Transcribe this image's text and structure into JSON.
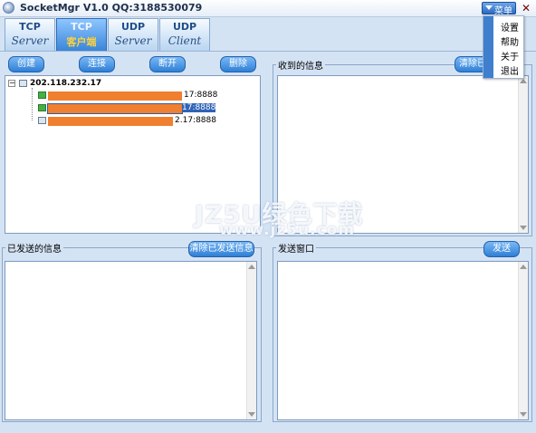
{
  "window": {
    "title": "SocketMgr V1.0  QQ:3188530079",
    "menu_label": "菜单",
    "close_glyph": "✕"
  },
  "menu_items": [
    "设置",
    "帮助",
    "关于",
    "退出"
  ],
  "tabs": [
    {
      "line1": "TCP",
      "line2": "Server"
    },
    {
      "line1": "TCP",
      "line2": "客户端"
    },
    {
      "line1": "UDP",
      "line2": "Server"
    },
    {
      "line1": "UDP",
      "line2": "Client"
    }
  ],
  "active_tab": 1,
  "toolbar": {
    "create": "创建",
    "connect": "连接",
    "disconnect": "断开",
    "delete": "删除"
  },
  "tree": {
    "root": "202.118.232.17",
    "connections": [
      {
        "label": "17:8888",
        "selected": false
      },
      {
        "label": "17:8888",
        "selected": true
      },
      {
        "label": "2.17:8888",
        "selected": false
      }
    ]
  },
  "received": {
    "group_label": "收到的信息",
    "clear_button": "清除已"
  },
  "sent": {
    "group_label": "已发送的信息",
    "clear_button": "清除已发送信息"
  },
  "send_window": {
    "group_label": "发送窗口",
    "send_button": "发送"
  },
  "watermark": {
    "line1": "JZ5U绿色下载",
    "line2": "www.jz5u.com"
  },
  "colors": {
    "accent": "#2f7fd6",
    "connection_bar": "#f07f2f",
    "background": "#d4e3f4"
  }
}
